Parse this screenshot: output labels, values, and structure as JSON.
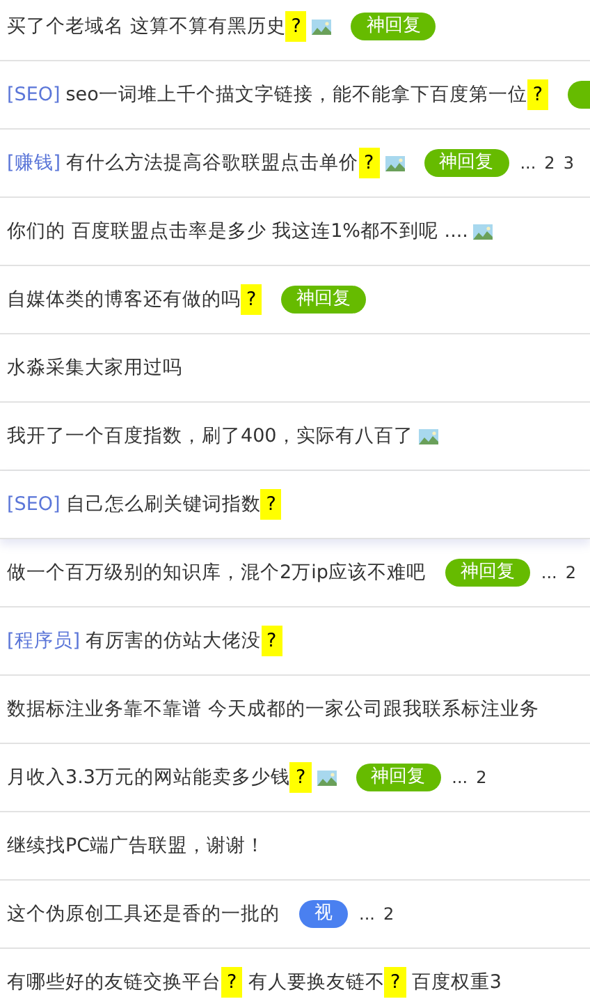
{
  "topics": [
    {
      "title": [
        {
          "kind": "text",
          "text": "买了个老域名 这算不算有黑历史"
        },
        {
          "kind": "highlight",
          "text": "?"
        }
      ],
      "has_image": true,
      "badge": {
        "label": "神回复",
        "color": "#66bb00"
      }
    },
    {
      "category": "[SEO]",
      "title": [
        {
          "kind": "text",
          "text": "seo一词堆上千个描文字链接，能不能拿下百度第一位"
        },
        {
          "kind": "highlight",
          "text": "?"
        }
      ],
      "badge": {
        "color": "#66bb00"
      }
    },
    {
      "category": "[赚钱]",
      "title": [
        {
          "kind": "text",
          "text": "有什么方法提高谷歌联盟点击单价"
        },
        {
          "kind": "highlight",
          "text": "?"
        }
      ],
      "has_image": true,
      "badge": {
        "label": "神回复",
        "color": "#66bb00"
      },
      "pager": {
        "ellipsis": "...",
        "pages": [
          "2",
          "3"
        ]
      }
    },
    {
      "title": [
        {
          "kind": "text",
          "text": "你们的 百度联盟点击率是多少 我这连1%都不到呢 ...."
        }
      ],
      "has_image": true
    },
    {
      "title": [
        {
          "kind": "text",
          "text": "自媒体类的博客还有做的吗"
        },
        {
          "kind": "highlight",
          "text": "?"
        }
      ],
      "badge": {
        "label": "神回复",
        "color": "#66bb00"
      }
    },
    {
      "title": [
        {
          "kind": "text",
          "text": "水淼采集大家用过吗"
        }
      ]
    },
    {
      "title": [
        {
          "kind": "text",
          "text": "我开了一个百度指数，刷了400，实际有八百了"
        }
      ],
      "has_image": true
    },
    {
      "category": "[SEO]",
      "title": [
        {
          "kind": "text",
          "text": "自己怎么刷关键词指数"
        },
        {
          "kind": "highlight",
          "text": "?"
        }
      ],
      "raised": true
    },
    {
      "title": [
        {
          "kind": "text",
          "text": "做一个百万级别的知识库，混个2万ip应该不难吧"
        }
      ],
      "badge": {
        "label": "神回复",
        "color": "#66bb00"
      },
      "pager": {
        "ellipsis": "...",
        "pages": [
          "2"
        ]
      }
    },
    {
      "category": "[程序员]",
      "title": [
        {
          "kind": "text",
          "text": "有厉害的仿站大佬没"
        },
        {
          "kind": "highlight",
          "text": "?"
        }
      ]
    },
    {
      "title": [
        {
          "kind": "text",
          "text": "数据标注业务靠不靠谱 今天成都的一家公司跟我联系标注业务"
        }
      ]
    },
    {
      "title": [
        {
          "kind": "text",
          "text": "月收入3.3万元的网站能卖多少钱"
        },
        {
          "kind": "highlight",
          "text": "?"
        }
      ],
      "has_image": true,
      "badge": {
        "label": "神回复",
        "color": "#66bb00"
      },
      "pager": {
        "ellipsis": "...",
        "pages": [
          "2"
        ]
      }
    },
    {
      "title": [
        {
          "kind": "text",
          "text": "继续找PC端广告联盟，谢谢！"
        }
      ]
    },
    {
      "title": [
        {
          "kind": "text",
          "text": "这个伪原创工具还是香的一批的"
        }
      ],
      "badge": {
        "label": "视",
        "color": "#4a80f0"
      },
      "pager": {
        "ellipsis": "...",
        "pages": [
          "2"
        ]
      }
    },
    {
      "title": [
        {
          "kind": "text",
          "text": "有哪些好的友链交换平台"
        },
        {
          "kind": "highlight",
          "text": "?"
        },
        {
          "kind": "text",
          "text": " 有人要换友链不"
        },
        {
          "kind": "highlight",
          "text": "?"
        },
        {
          "kind": "text",
          "text": " 百度权重3"
        }
      ]
    }
  ]
}
